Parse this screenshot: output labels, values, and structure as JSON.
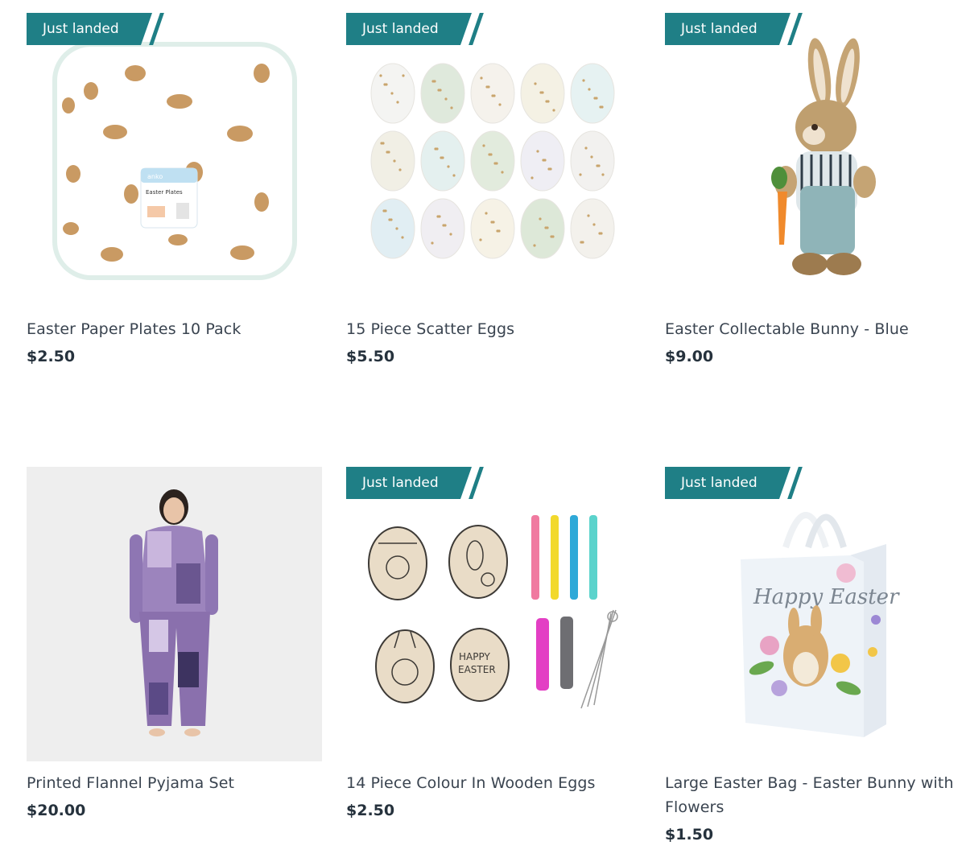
{
  "badge_label": "Just landed",
  "colors": {
    "badge": "#1f7f86",
    "price": "#26323d",
    "title": "#3a4450"
  },
  "products": [
    {
      "title": "Easter Paper Plates 10 Pack",
      "price": "$2.50",
      "badge": true,
      "package": {
        "brand": "anko",
        "name": "Easter Plates"
      }
    },
    {
      "title": "15 Piece Scatter Eggs",
      "price": "$5.50",
      "badge": true
    },
    {
      "title": "Easter Collectable Bunny - Blue",
      "price": "$9.00",
      "badge": true
    },
    {
      "title": "Printed Flannel Pyjama Set",
      "price": "$20.00",
      "badge": false
    },
    {
      "title": "14 Piece Colour In Wooden Eggs",
      "price": "$2.50",
      "badge": true,
      "egg_text": [
        "HAPPY",
        "EASTER"
      ]
    },
    {
      "title": "Large Easter Bag - Easter Bunny with Flowers",
      "price": "$1.50",
      "badge": true,
      "bag_text": "Happy Easter"
    }
  ]
}
